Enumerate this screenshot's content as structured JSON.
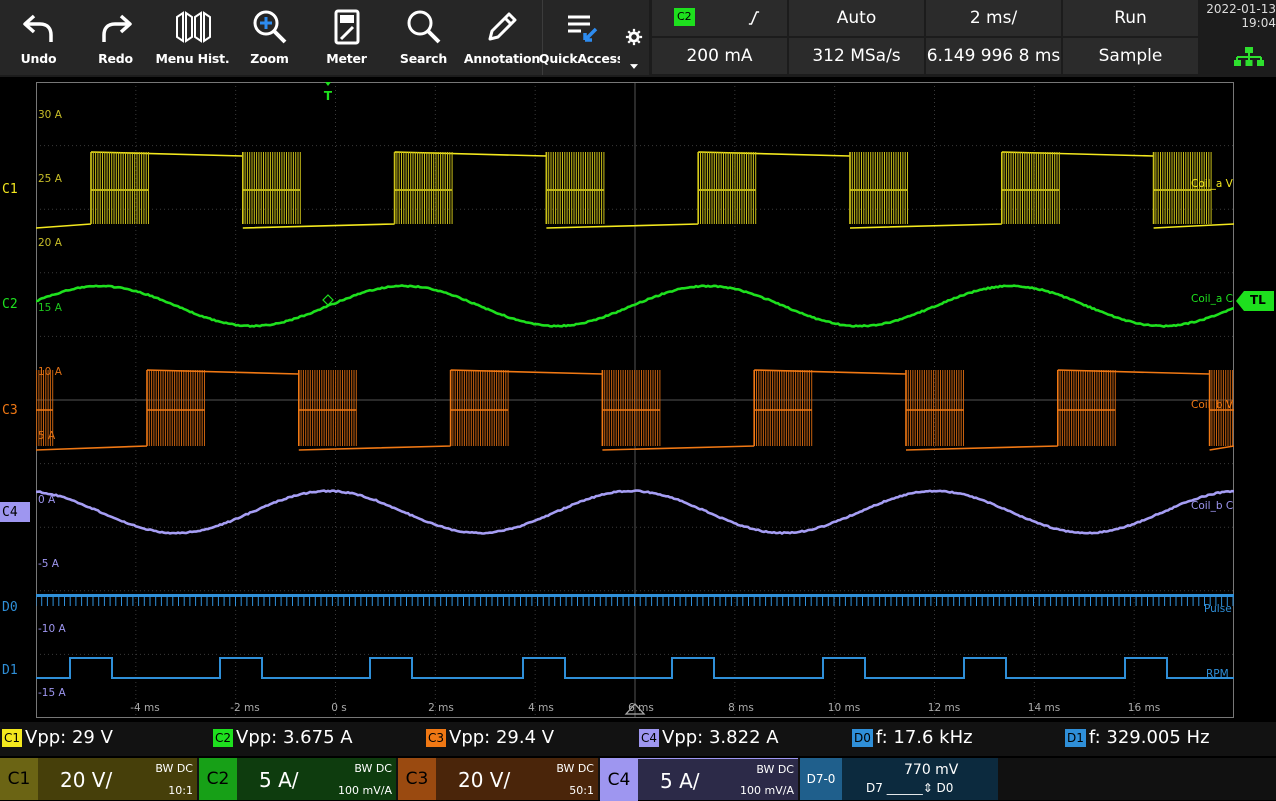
{
  "toolbar": {
    "buttons": [
      {
        "label": "Undo",
        "icon": "undo-icon"
      },
      {
        "label": "Redo",
        "icon": "redo-icon"
      },
      {
        "label": "Menu Hist.",
        "icon": "menu-history-icon"
      },
      {
        "label": "Zoom",
        "icon": "zoom-icon"
      },
      {
        "label": "Meter",
        "icon": "meter-icon"
      },
      {
        "label": "Search",
        "icon": "search-icon"
      },
      {
        "label": "Annotation",
        "icon": "pencil-icon"
      },
      {
        "label": "QuickAccess",
        "icon": "quick-access-icon"
      }
    ]
  },
  "trigger": {
    "source": "C2",
    "slope_icon": "rising-edge-icon",
    "mode": "Auto",
    "timebase": "2 ms/",
    "run_state": "Run",
    "level": "200 mA",
    "sample_rate": "312 MSa/s",
    "position": "6.149 996 8 ms",
    "acq_mode": "Sample"
  },
  "datetime": {
    "date": "2022-01-13",
    "time": "19:04"
  },
  "colors": {
    "c1": "#f3e81e",
    "c2": "#1ee01e",
    "c3": "#f07814",
    "c4": "#9e96f0",
    "digital": "#2f8fd8"
  },
  "channels": {
    "c1": {
      "label": "C1",
      "trace": "Coil_a V"
    },
    "c2": {
      "label": "C2",
      "trace": "Coil_a C"
    },
    "c3": {
      "label": "C3",
      "trace": "Coil_b V"
    },
    "c4": {
      "label": "C4",
      "trace": "Coil_b C"
    },
    "d0": {
      "label": "D0",
      "trace": "Pulse"
    },
    "d1": {
      "label": "D1",
      "trace": "RPM"
    },
    "trigger_level_label": "TL",
    "trigger_marker": "T"
  },
  "y_labels": [
    {
      "text": "30 A",
      "color": "c1"
    },
    {
      "text": "25 A",
      "color": "c1"
    },
    {
      "text": "20 A",
      "color": "c1"
    },
    {
      "text": "15 A",
      "color": "c2"
    },
    {
      "text": "10 A",
      "color": "c3"
    },
    {
      "text": "5 A",
      "color": "c3"
    },
    {
      "text": "0 A",
      "color": "c4"
    },
    {
      "text": "-5 A",
      "color": "c4"
    },
    {
      "text": "-10 A",
      "color": "c4"
    },
    {
      "text": "-15 A",
      "color": "c4"
    }
  ],
  "x_labels": [
    "-4 ms",
    "-2 ms",
    "0 s",
    "2 ms",
    "4 ms",
    "6 ms",
    "8 ms",
    "10 ms",
    "12 ms",
    "14 ms",
    "16 ms"
  ],
  "measurements": [
    {
      "badge": "C1",
      "label": "Vpp:",
      "value": "29 V"
    },
    {
      "badge": "C2",
      "label": "Vpp:",
      "value": "3.675 A"
    },
    {
      "badge": "C3",
      "label": "Vpp:",
      "value": "29.4 V"
    },
    {
      "badge": "C4",
      "label": "Vpp:",
      "value": "3.822 A"
    },
    {
      "badge": "D0",
      "label": "f:",
      "value": "17.6 kHz"
    },
    {
      "badge": "D1",
      "label": "f:",
      "value": "329.005 Hz"
    }
  ],
  "channel_bar": [
    {
      "label": "C1",
      "scale": "20 V/",
      "bw": "BW DC",
      "probe": "10:1"
    },
    {
      "label": "C2",
      "scale": "5 A/",
      "bw": "BW DC",
      "probe": "100 mV/A"
    },
    {
      "label": "C3",
      "scale": "20 V/",
      "bw": "BW DC",
      "probe": "50:1"
    },
    {
      "label": "C4",
      "scale": "5 A/",
      "bw": "BW DC",
      "probe": "100 mV/A"
    }
  ],
  "digital_box": {
    "label": "D7-0",
    "threshold": "770 mV",
    "range": "D7 ______⇕ D0"
  }
}
